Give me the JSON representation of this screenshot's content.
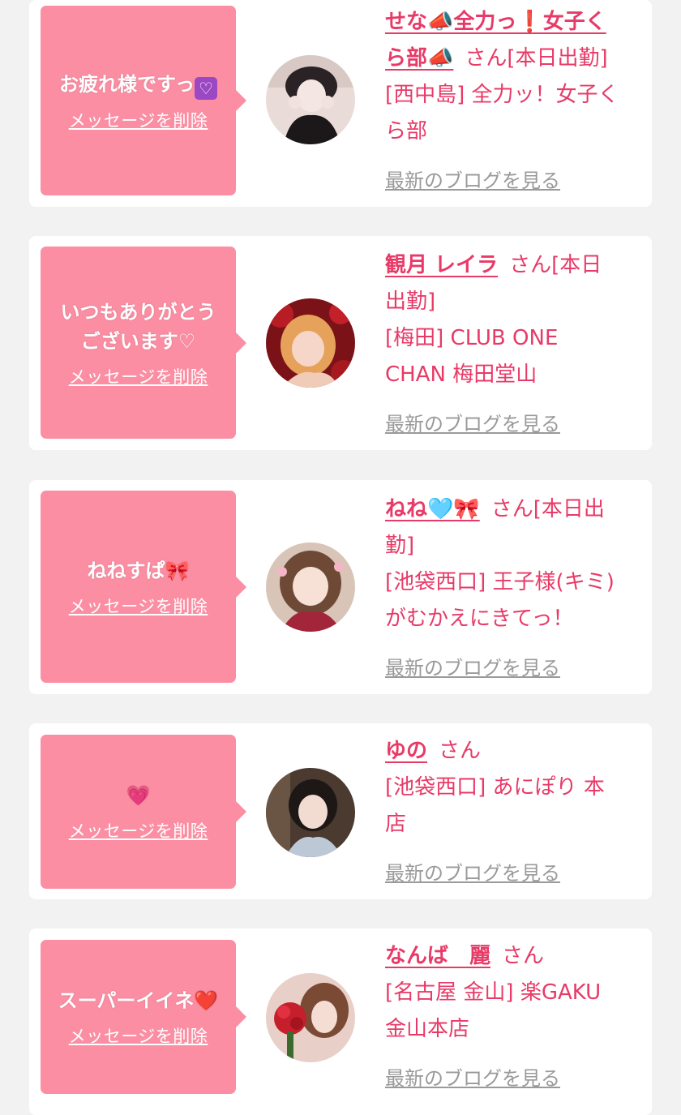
{
  "cards": [
    {
      "message": "お疲れ様ですっ",
      "message_emoji": "💜",
      "delete_label": "メッセージを削除",
      "name_a": "せな📣全力っ❗女子く",
      "name_b": "ら部📣",
      "san_status": "さん[本日出勤]",
      "shop_line1": "[西中島] 全力ッ！女子く",
      "shop_line2": "ら部",
      "blog_label": "最新のブログを見る"
    },
    {
      "message_line1": "いつもありがとう",
      "message_line2": "ございます♡",
      "delete_label": "メッセージを削除",
      "name": "観月 レイラ",
      "san_status_a": "さん[本日",
      "san_status_b": "出勤]",
      "shop_line1": "[梅田] CLUB ONE",
      "shop_line2": "CHAN 梅田堂山",
      "blog_label": "最新のブログを見る"
    },
    {
      "message": "ねねすぱ🎀",
      "delete_label": "メッセージを削除",
      "name": "ねね🩵🎀",
      "san_status_a": "さん[本日出",
      "san_status_b": "勤]",
      "shop_line1": "[池袋西口] 王子様(キミ)",
      "shop_line2": "がむかえにきてっ！",
      "blog_label": "最新のブログを見る"
    },
    {
      "message": "💗",
      "delete_label": "メッセージを削除",
      "name": "ゆの",
      "san": "さん",
      "shop_line1": "[池袋西口] あにぽり 本",
      "shop_line2": "店",
      "blog_label": "最新のブログを見る"
    },
    {
      "message": "スーパーイイネ❤️",
      "delete_label": "メッセージを削除",
      "name": "なんば　麗",
      "san": "さん",
      "shop_line1": "[名古屋 金山] 楽GAKU",
      "shop_line2": "金山本店",
      "blog_label": "最新のブログを見る"
    }
  ],
  "colors": {
    "bubble": "#fb8ea3",
    "accent_text": "#e83a67",
    "blog_link": "#9a9a9a",
    "background": "#f2f2f2"
  }
}
